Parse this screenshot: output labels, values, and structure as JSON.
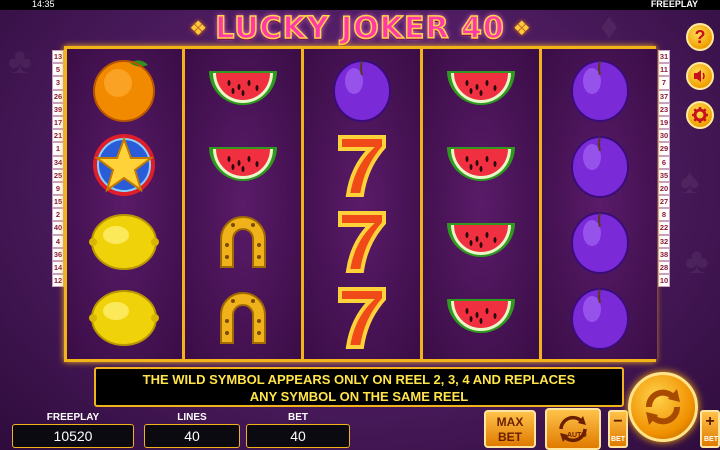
{
  "status_bar": {
    "time": "14:35",
    "mode": "FREEPLAY"
  },
  "title": {
    "text": "LUCKY JOKER 40"
  },
  "line_numbers": {
    "left": [
      "13",
      "5",
      "3",
      "26",
      "39",
      "17",
      "21",
      "1",
      "34",
      "25",
      "9",
      "15",
      "2",
      "40",
      "4",
      "36",
      "14",
      "12"
    ],
    "right": [
      "31",
      "11",
      "7",
      "37",
      "23",
      "19",
      "30",
      "29",
      "6",
      "35",
      "20",
      "27",
      "8",
      "22",
      "32",
      "38",
      "28",
      "10"
    ]
  },
  "reels": [
    [
      "orange",
      "star",
      "lemon",
      "lemon"
    ],
    [
      "watermelon",
      "watermelon",
      "horseshoe",
      "horseshoe"
    ],
    [
      "plum",
      "seven",
      "seven",
      "seven"
    ],
    [
      "watermelon",
      "watermelon",
      "watermelon",
      "watermelon"
    ],
    [
      "plum",
      "plum",
      "plum",
      "plum"
    ]
  ],
  "info_text": {
    "line1": "THE WILD SYMBOL APPEARS ONLY ON REEL 2, 3, 4 AND REPLACES",
    "line2": "ANY SYMBOL ON THE SAME REEL"
  },
  "fields": {
    "freeplay_label": "FREEPLAY",
    "freeplay_value": "10520",
    "lines_label": "LINES",
    "lines_value": "40",
    "bet_label": "BET",
    "bet_value": "40"
  },
  "buttons": {
    "max_bet": "MAX BET",
    "auto": "AUTO",
    "bet_minus": "−",
    "bet_plus": "+",
    "bet_minus_sub": "BET",
    "bet_plus_sub": "BET",
    "help": "?"
  },
  "colors": {
    "accent_gold": "#f2b21a",
    "title_pink": "#ff3aa8",
    "info_yellow": "#ffe44a"
  }
}
